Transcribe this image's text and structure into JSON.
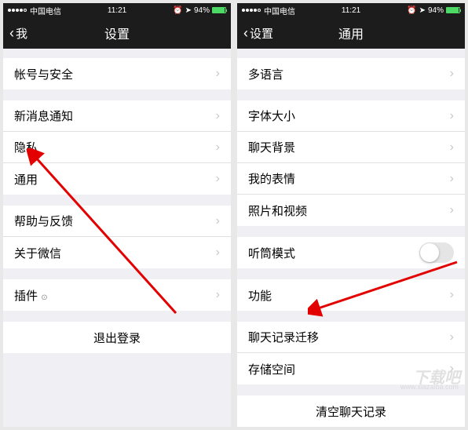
{
  "status": {
    "carrier": "中国电信",
    "time": "11:21",
    "battery": "94%"
  },
  "left": {
    "back": "我",
    "title": "设置",
    "group1": {
      "item1": "帐号与安全"
    },
    "group2": {
      "item1": "新消息通知",
      "item2": "隐私",
      "item3": "通用"
    },
    "group3": {
      "item1": "帮助与反馈",
      "item2": "关于微信"
    },
    "group4": {
      "item1": "插件"
    },
    "logout": "退出登录"
  },
  "right": {
    "back": "设置",
    "title": "通用",
    "group1": {
      "item1": "多语言"
    },
    "group2": {
      "item1": "字体大小",
      "item2": "聊天背景",
      "item3": "我的表情",
      "item4": "照片和视频"
    },
    "group3": {
      "item1": "听筒模式"
    },
    "group4": {
      "item1": "功能"
    },
    "group5": {
      "item1": "聊天记录迁移",
      "item2": "存储空间"
    },
    "clear": "清空聊天记录"
  },
  "watermark": "下载吧",
  "watermark_url": "www.xiazaiba.com"
}
